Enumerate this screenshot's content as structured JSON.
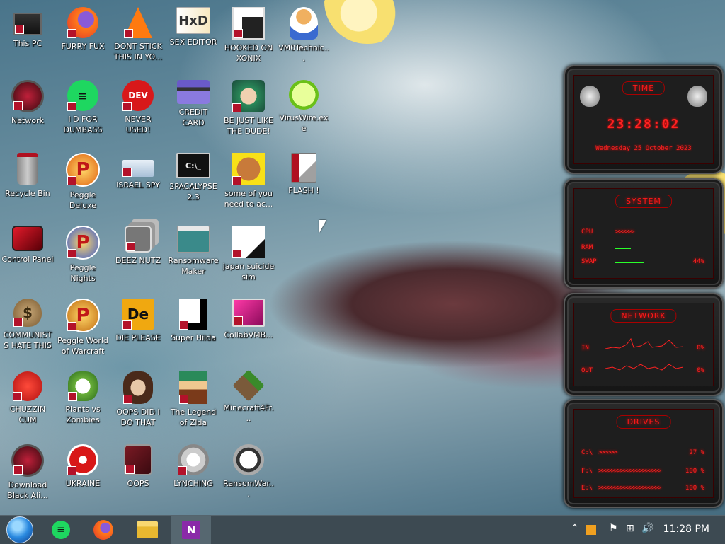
{
  "desktop": {
    "icons": [
      {
        "label": "This PC",
        "icon": "monitor-icon"
      },
      {
        "label": "FURRY FUX",
        "icon": "firefox-icon"
      },
      {
        "label": "DONT STICK THIS IN YO...",
        "icon": "traffic-cone-icon"
      },
      {
        "label": "SEX EDITOR",
        "icon": "hxd-editor-icon"
      },
      {
        "label": "HOOKED ON XONIX",
        "icon": "xonix-game-icon"
      },
      {
        "label": "VM0Technic...",
        "icon": "doctor-avatar-icon"
      },
      {
        "label": "Network",
        "icon": "alien-network-icon"
      },
      {
        "label": "I D FOR DUMBASS",
        "icon": "green-chat-icon"
      },
      {
        "label": "NEVER USED!",
        "icon": "devcpp-icon"
      },
      {
        "label": "CREDIT CARD CHECKER",
        "icon": "credit-card-icon"
      },
      {
        "label": "BE JUST LIKE THE DUDE!",
        "icon": "santa-elf-icon"
      },
      {
        "label": "VirusWire.exe",
        "icon": "lime-icon"
      },
      {
        "label": "Recycle Bin",
        "icon": "recycle-bin-icon"
      },
      {
        "label": "Peggle Deluxe",
        "icon": "peggle-icon"
      },
      {
        "label": "ISRAEL SPY",
        "icon": "network-computer-icon"
      },
      {
        "label": "2PACALYPSE 2.3",
        "icon": "terminal-icon"
      },
      {
        "label": "some of you need to ac...",
        "icon": "cartoon-dog-icon"
      },
      {
        "label": "FLASH !",
        "icon": "flash-doc-icon"
      },
      {
        "label": "Control Panel",
        "icon": "control-panel-icon"
      },
      {
        "label": "Peggle Nights Deluxe",
        "icon": "peggle-nights-icon"
      },
      {
        "label": "DEEZ NUTZ",
        "icon": "stacked-windows-icon"
      },
      {
        "label": "Ransomware Maker Build...",
        "icon": "window-app-icon"
      },
      {
        "label": "japan suicide sim",
        "icon": "game-icon"
      },
      {
        "label": "COMMUNISTS HATE THIS G...",
        "icon": "money-bag-icon"
      },
      {
        "label": "Peggle World of Warcraft ...",
        "icon": "peggle-wow-icon"
      },
      {
        "label": "DIE PLEASE",
        "icon": "die-icon"
      },
      {
        "label": "Super Hilda",
        "icon": "pixel-dog-icon"
      },
      {
        "label": "CollabVMB...",
        "icon": "collabvm-icon"
      },
      {
        "label": "CHUZZIN CUM",
        "icon": "chuzzle-icon"
      },
      {
        "label": "Plants vs Zombies",
        "icon": "plant-icon"
      },
      {
        "label": "OOPS DID I DO THAT",
        "icon": "portrait-icon"
      },
      {
        "label": "The Legend of Zlda",
        "icon": "pixel-hero-icon"
      },
      {
        "label": "Minecraft4Fr...",
        "icon": "grass-block-icon"
      },
      {
        "label": "Download Black Ali...",
        "icon": "alien-download-icon"
      },
      {
        "label": "UKRAINE",
        "icon": "radiation-icon"
      },
      {
        "label": "OOPS",
        "icon": "red-box-icon"
      },
      {
        "label": "LYNCHING",
        "icon": "emblem-icon"
      },
      {
        "label": "RansomWar...",
        "icon": "skull-icon"
      }
    ]
  },
  "gadgets": {
    "time": {
      "title": "TIME",
      "clock": "23:28:02",
      "date": "Wednesday 25 October 2023"
    },
    "system": {
      "title": "SYSTEM",
      "cpu_label": "CPU",
      "ram_label": "RAM",
      "swap_label": "SWAP",
      "swap_value": "44%"
    },
    "network": {
      "title": "NETWORK",
      "in_label": "IN",
      "in_value": "0%",
      "out_label": "OUT",
      "out_value": "0%"
    },
    "drives": {
      "title": "DRIVES",
      "c_label": "C:\\",
      "c_value": "27 %",
      "f_label": "F:\\",
      "f_value": "100 %",
      "e_label": "E:\\",
      "e_value": "100 %"
    }
  },
  "taskbar": {
    "clock": "11:28 PM",
    "pinned": [
      "start-orb-icon",
      "green-chat-icon",
      "firefox-icon",
      "file-explorer-icon",
      "onenote-icon"
    ]
  }
}
